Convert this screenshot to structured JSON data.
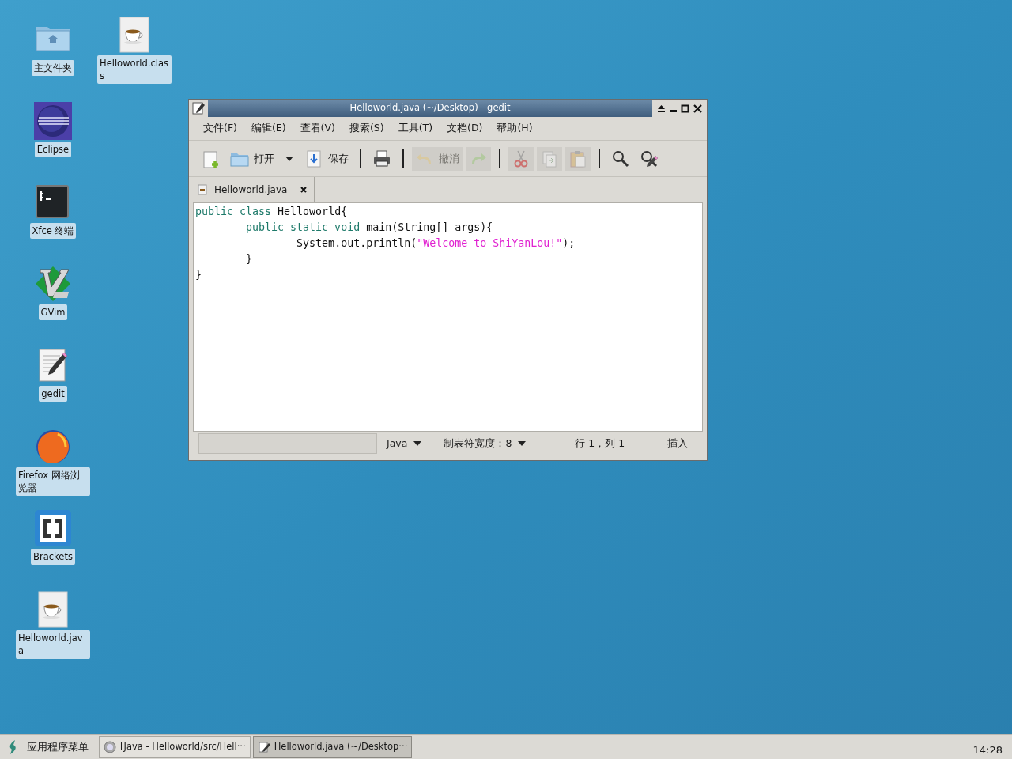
{
  "desktop_icons": [
    [
      {
        "kind": "folder",
        "label": "主文件夹"
      },
      {
        "kind": "eclipse",
        "label": "Eclipse"
      },
      {
        "kind": "terminal",
        "label": "Xfce 终端"
      },
      {
        "kind": "vim",
        "label": "GVim"
      },
      {
        "kind": "gedit",
        "label": "gedit"
      },
      {
        "kind": "firefox",
        "label": "Firefox 网络浏览器"
      },
      {
        "kind": "brackets",
        "label": "Brackets"
      },
      {
        "kind": "java",
        "label": "Helloworld.java"
      }
    ],
    [
      {
        "kind": "java",
        "label": "Helloworld.class"
      }
    ]
  ],
  "window": {
    "title": "Helloworld.java (~/Desktop) - gedit",
    "menu": [
      "文件(F)",
      "编辑(E)",
      "查看(V)",
      "搜索(S)",
      "工具(T)",
      "文档(D)",
      "帮助(H)"
    ],
    "toolbar": [
      {
        "kind": "new",
        "disabled": false
      },
      {
        "kind": "open",
        "label": "打开",
        "disabled": false
      },
      {
        "kind": "dropdown",
        "disabled": false
      },
      {
        "kind": "save",
        "label": "保存",
        "disabled": false
      },
      {
        "kind": "separator"
      },
      {
        "kind": "print",
        "disabled": false
      },
      {
        "kind": "separator"
      },
      {
        "kind": "undo",
        "label": "撤消",
        "disabled": true
      },
      {
        "kind": "redo",
        "disabled": true
      },
      {
        "kind": "separator"
      },
      {
        "kind": "cut",
        "disabled": true
      },
      {
        "kind": "copy",
        "disabled": true
      },
      {
        "kind": "paste",
        "disabled": true
      },
      {
        "kind": "separator"
      },
      {
        "kind": "search",
        "disabled": false
      },
      {
        "kind": "replace",
        "disabled": false
      }
    ],
    "tabs": [
      {
        "label": "Helloworld.java",
        "selected": true
      }
    ],
    "code": [
      [
        {
          "kind": "keyword",
          "text": "public class"
        },
        {
          "kind": "plain",
          "text": " Helloworld{"
        }
      ],
      [
        {
          "kind": "keyword",
          "text": "\tpublic static void"
        },
        {
          "kind": "plain",
          "text": " main(String[] args){"
        }
      ],
      [
        {
          "kind": "plain",
          "text": "\t\tSystem.out.println("
        },
        {
          "kind": "string",
          "text": "\"Welcome to ShiYanLou!\""
        },
        {
          "kind": "plain",
          "text": ");"
        }
      ],
      [
        {
          "kind": "plain",
          "text": "\t}"
        }
      ],
      [
        {
          "kind": "plain",
          "text": "}"
        }
      ]
    ],
    "status_bar": {
      "language": "Java",
      "tab_width": "制表符宽度：8",
      "position": "行 1，列 1",
      "mode": "插入"
    }
  },
  "taskbar": {
    "app_menu": "应用程序菜单",
    "tasks": [
      {
        "kind": "eclipse",
        "label": "[Java - Helloworld/src/Hell···",
        "selected": false
      },
      {
        "kind": "gedit",
        "label": "Helloworld.java (~/Desktop···",
        "selected": true
      }
    ],
    "clock": "14:28"
  }
}
